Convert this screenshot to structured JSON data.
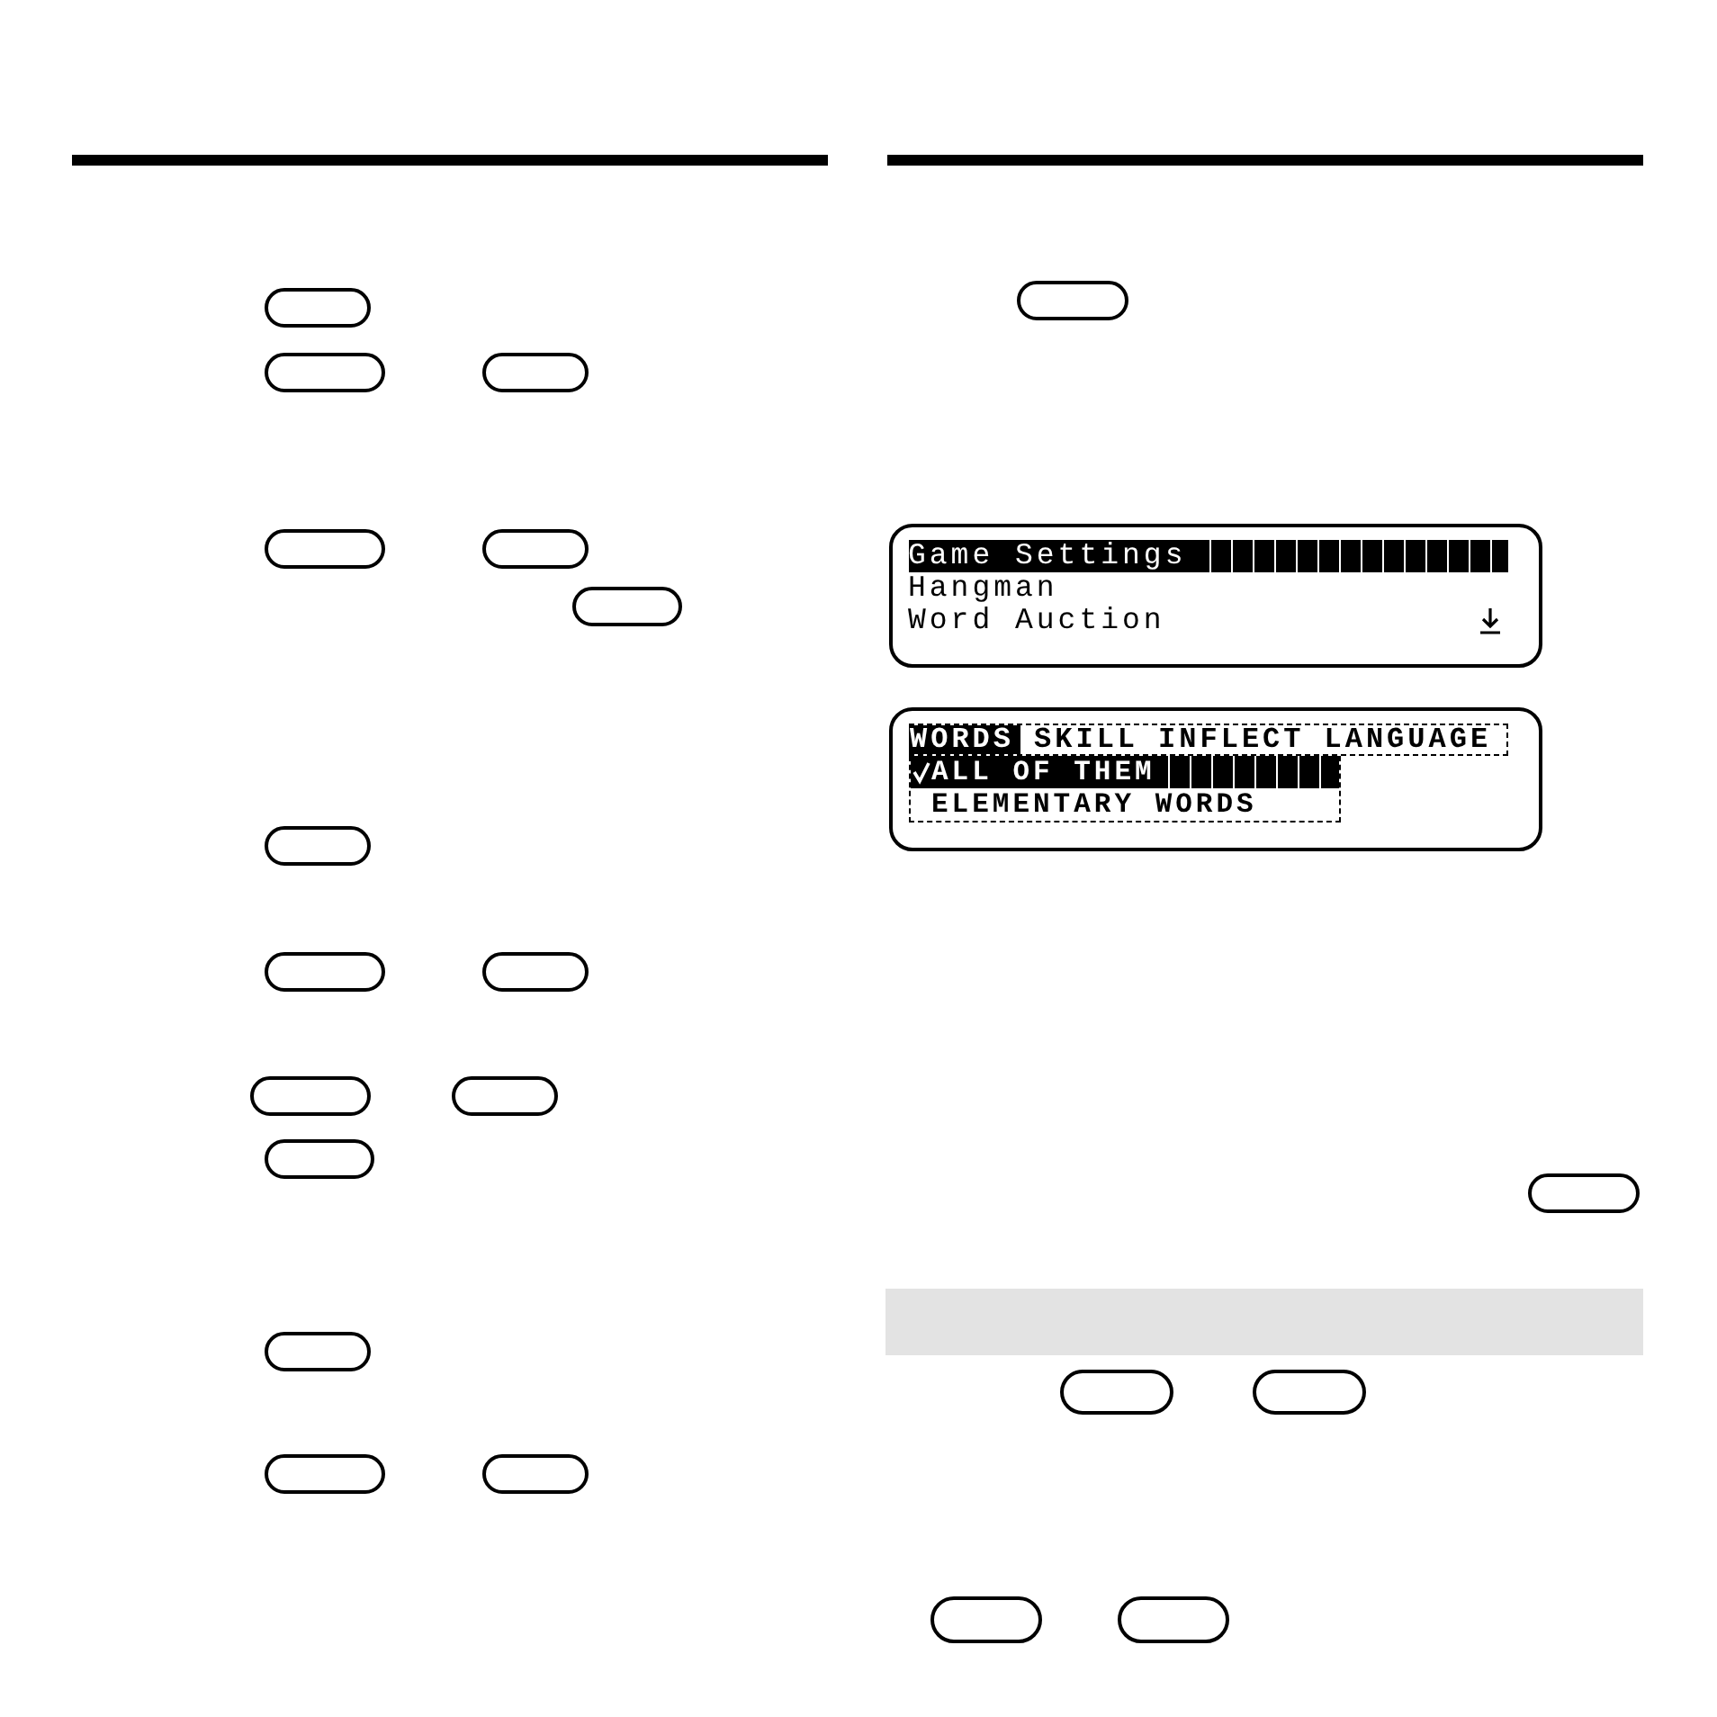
{
  "lcd_screens": [
    {
      "kind": "menu",
      "items": [
        {
          "label": "Game Settings",
          "selected": true
        },
        {
          "label": "Hangman",
          "selected": false
        },
        {
          "label": "Word Auction",
          "selected": false
        }
      ],
      "more_below": true
    },
    {
      "kind": "tabs",
      "tabs": [
        {
          "label": "WORDS",
          "selected": true
        },
        {
          "label": "SKILL",
          "selected": false
        },
        {
          "label": "INFLECT",
          "selected": false
        },
        {
          "label": "LANGUAGE",
          "selected": false
        }
      ],
      "options": [
        {
          "label": "ALL OF THEM",
          "checked": true,
          "selected": true
        },
        {
          "label": "ELEMENTARY WORDS",
          "checked": false,
          "selected": false
        }
      ]
    }
  ]
}
